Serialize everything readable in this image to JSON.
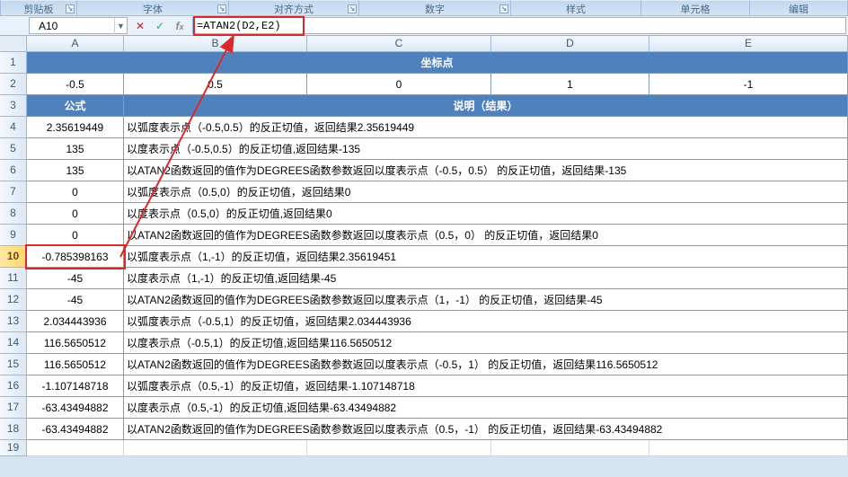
{
  "ribbon": {
    "groups": [
      "剪贴板",
      "字体",
      "",
      "对齐方式",
      "数字",
      "样式",
      "单元格",
      "编辑"
    ]
  },
  "nameBox": "A10",
  "formulaBar": "=ATAN2(D2,E2)",
  "colHeaders": [
    "A",
    "B",
    "C",
    "D",
    "E"
  ],
  "rowHeaders": [
    "1",
    "2",
    "3",
    "4",
    "5",
    "6",
    "7",
    "8",
    "9",
    "10",
    "11",
    "12",
    "13",
    "14",
    "15",
    "16",
    "17",
    "18",
    "19"
  ],
  "r1_title": "坐标点",
  "r2": {
    "a": "-0.5",
    "b": "0.5",
    "c": "0",
    "d": "1",
    "e": "-1"
  },
  "r3": {
    "a": "公式",
    "rest": "说明（结果）"
  },
  "rows": [
    {
      "a": "2.35619449",
      "b": "以弧度表示点（-0.5,0.5）的反正切值，返回结果2.35619449"
    },
    {
      "a": "135",
      "b": "以度表示点（-0.5,0.5）的反正切值,返回结果-135"
    },
    {
      "a": "135",
      "b": "以ATAN2函数返回的值作为DEGREES函数参数返回以度表示点（-0.5，0.5）  的反正切值，返回结果-135"
    },
    {
      "a": "0",
      "b": "以弧度表示点（0.5,0）的反正切值，返回结果0"
    },
    {
      "a": "0",
      "b": "以度表示点（0.5,0）的反正切值,返回结果0"
    },
    {
      "a": "0",
      "b": "以ATAN2函数返回的值作为DEGREES函数参数返回以度表示点（0.5，0）  的反正切值，返回结果0"
    },
    {
      "a": "-0.785398163",
      "b": "以弧度表示点（1,-1）的反正切值，返回结果2.35619451"
    },
    {
      "a": "-45",
      "b": "以度表示点（1,-1）的反正切值,返回结果-45"
    },
    {
      "a": "-45",
      "b": "以ATAN2函数返回的值作为DEGREES函数参数返回以度表示点（1，-1）  的反正切值，返回结果-45"
    },
    {
      "a": "2.034443936",
      "b": "以弧度表示点（-0.5,1）的反正切值，返回结果2.034443936"
    },
    {
      "a": "116.5650512",
      "b": "以度表示点（-0.5,1）的反正切值,返回结果116.5650512"
    },
    {
      "a": "116.5650512",
      "b": "以ATAN2函数返回的值作为DEGREES函数参数返回以度表示点（-0.5，1）  的反正切值，返回结果116.5650512"
    },
    {
      "a": "-1.107148718",
      "b": "以弧度表示点（0.5,-1）的反正切值，返回结果-1.107148718"
    },
    {
      "a": "-63.43494882",
      "b": "以度表示点（0.5,-1）的反正切值,返回结果-63.43494882"
    },
    {
      "a": "-63.43494882",
      "b": "以ATAN2函数返回的值作为DEGREES函数参数返回以度表示点（0.5，-1）  的反正切值，返回结果-63.43494882"
    }
  ]
}
